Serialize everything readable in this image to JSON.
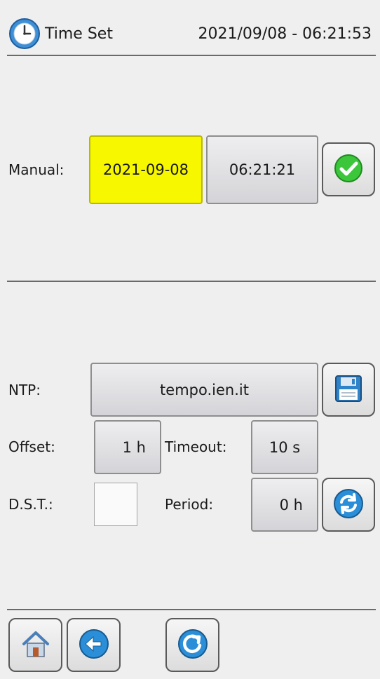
{
  "header": {
    "title": "Time Set",
    "datetime": "2021/09/08 - 06:21:53",
    "icon": "clock-icon"
  },
  "manual": {
    "label": "Manual:",
    "date": "2021-09-08",
    "time": "06:21:21",
    "confirm_icon": "check-icon"
  },
  "ntp": {
    "label": "NTP:",
    "server": "tempo.ien.it",
    "save_icon": "save-icon",
    "offset_label": "Offset:",
    "offset_value": "1 h",
    "timeout_label": "Timeout:",
    "timeout_value": "10 s",
    "dst_label": "D.S.T.:",
    "dst_checked": false,
    "period_label": "Period:",
    "period_value": "0 h",
    "sync_icon": "sync-icon"
  },
  "footer": {
    "home_icon": "home-icon",
    "back_icon": "back-arrow-icon",
    "refresh_icon": "refresh-icon"
  },
  "colors": {
    "accent_yellow": "#f7f700",
    "confirm_green": "#3cc63c",
    "icon_blue": "#2a8fd8"
  }
}
